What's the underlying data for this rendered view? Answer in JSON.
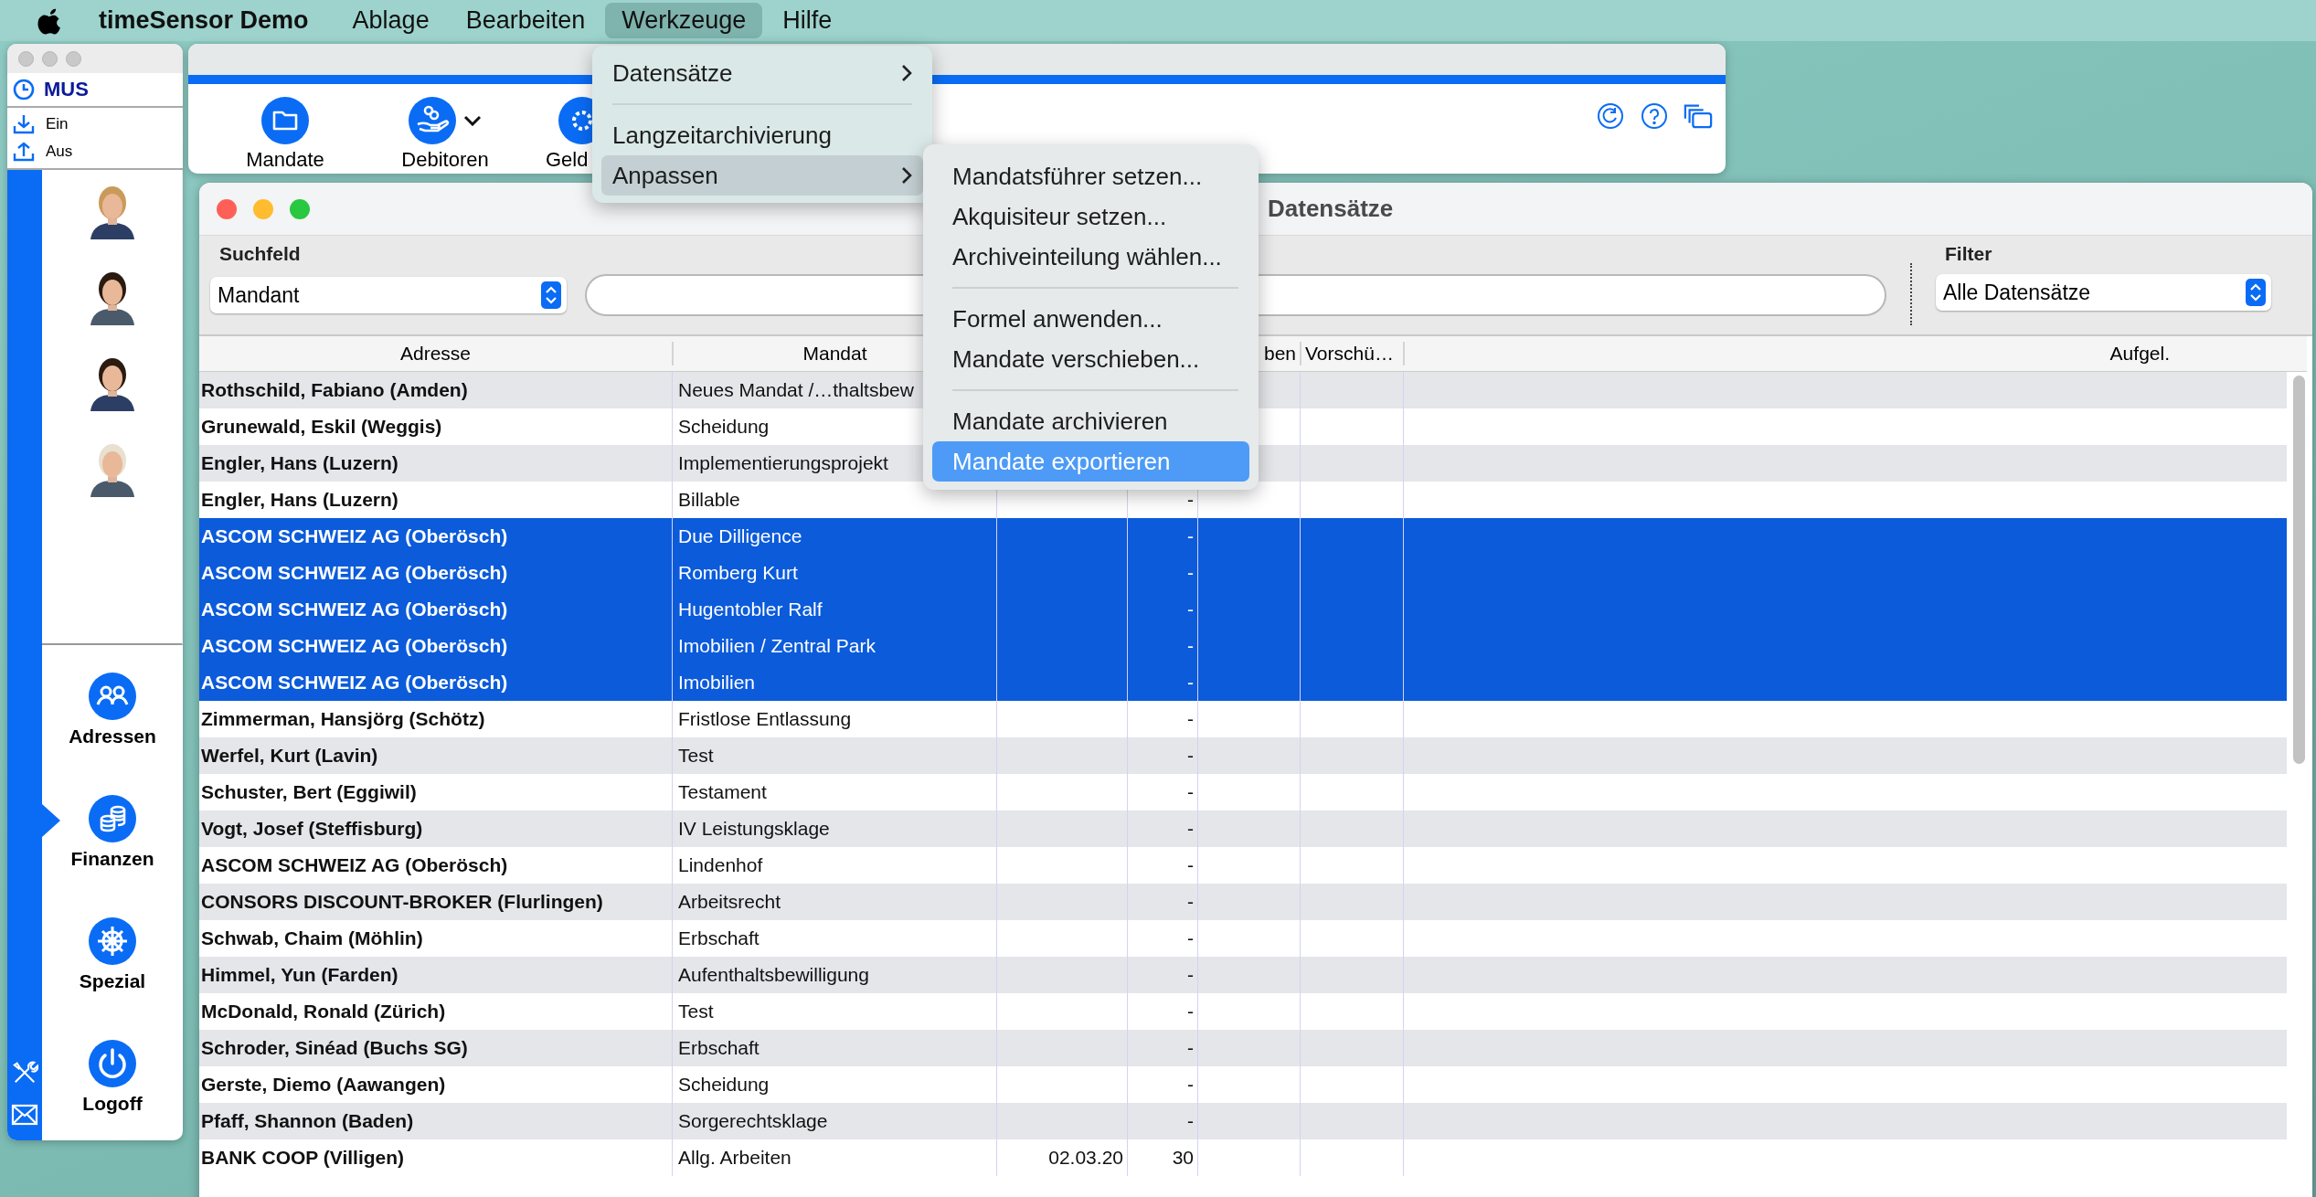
{
  "menubar": {
    "app": "timeSensor Demo",
    "items": [
      {
        "label": "Ablage",
        "selected": false
      },
      {
        "label": "Bearbeiten",
        "selected": false
      },
      {
        "label": "Werkzeuge",
        "selected": true
      },
      {
        "label": "Hilfe",
        "selected": false
      }
    ]
  },
  "menu": {
    "items": [
      {
        "kind": "submenu",
        "label": "Datensätze",
        "selected": false
      },
      {
        "kind": "separator"
      },
      {
        "kind": "item",
        "label": "Langzeitarchivierung",
        "selected": false
      },
      {
        "kind": "submenu",
        "label": "Anpassen",
        "selected": true
      }
    ]
  },
  "submenu": {
    "items": [
      {
        "kind": "item",
        "label": "Mandatsführer setzen...",
        "selected": false
      },
      {
        "kind": "item",
        "label": "Akquisiteur setzen...",
        "selected": false
      },
      {
        "kind": "item",
        "label": "Archiveinteilung wählen...",
        "selected": false
      },
      {
        "kind": "separator"
      },
      {
        "kind": "item",
        "label": "Formel anwenden...",
        "selected": false
      },
      {
        "kind": "item",
        "label": "Mandate verschieben...",
        "selected": false
      },
      {
        "kind": "separator"
      },
      {
        "kind": "item",
        "label": "Mandate archivieren",
        "selected": false
      },
      {
        "kind": "item",
        "label": "Mandate exportieren",
        "selected": true
      }
    ]
  },
  "side_panel": {
    "user": "MUS",
    "punch": [
      {
        "kind": "in",
        "label": "Ein"
      },
      {
        "kind": "out",
        "label": "Aus"
      }
    ],
    "nav": [
      {
        "kind": "people",
        "label": "Adressen",
        "selected": false
      },
      {
        "kind": "coins",
        "label": "Finanzen",
        "selected": true
      },
      {
        "kind": "wheel",
        "label": "Spezial",
        "selected": false
      },
      {
        "kind": "power",
        "label": "Logoff",
        "selected": false
      }
    ]
  },
  "toolbar": {
    "buttons": [
      {
        "kind": "folder",
        "label": "Mandate",
        "dropdown": false
      },
      {
        "kind": "hand",
        "label": "Debitoren",
        "dropdown": true
      },
      {
        "kind": "gear",
        "label": "Geld"
      }
    ]
  },
  "window": {
    "title": "Datensätze"
  },
  "search": {
    "label": "Suchfeld",
    "field": "Mandant"
  },
  "filter": {
    "label": "Filter",
    "value": "Alle Datensätze"
  },
  "table": {
    "columns": {
      "address": "Adresse",
      "mandate": "Mandat",
      "column_5": "ben",
      "column_6": "Vorschü…",
      "column_7": "Aufgel."
    },
    "rows": [
      {
        "address": "Rothschild, Fabiano (Amden)",
        "mandate": "Neues Mandat /…thaltsbew",
        "selected": false
      },
      {
        "address": "Grunewald, Eskil (Weggis)",
        "mandate": "Scheidung",
        "selected": false
      },
      {
        "address": "Engler, Hans (Luzern)",
        "mandate": "Implementierungsprojekt",
        "selected": false
      },
      {
        "address": "Engler, Hans (Luzern)",
        "mandate": "Billable",
        "column_4": "-",
        "selected": false
      },
      {
        "address": "ASCOM SCHWEIZ AG (Oberösch)",
        "mandate": "Due Dilligence",
        "column_4": "-",
        "selected": true
      },
      {
        "address": "ASCOM SCHWEIZ AG (Oberösch)",
        "mandate": "Romberg Kurt",
        "column_4": "-",
        "selected": true
      },
      {
        "address": "ASCOM SCHWEIZ AG (Oberösch)",
        "mandate": "Hugentobler Ralf",
        "column_4": "-",
        "selected": true
      },
      {
        "address": "ASCOM SCHWEIZ AG (Oberösch)",
        "mandate": "Imobilien / Zentral Park",
        "column_4": "-",
        "selected": true
      },
      {
        "address": "ASCOM SCHWEIZ AG (Oberösch)",
        "mandate": "Imobilien",
        "column_4": "-",
        "selected": true
      },
      {
        "address": "Zimmerman, Hansjörg (Schötz)",
        "mandate": "Fristlose Entlassung",
        "column_4": "-",
        "selected": false
      },
      {
        "address": "Werfel, Kurt (Lavin)",
        "mandate": "Test",
        "column_4": "-",
        "selected": false
      },
      {
        "address": "Schuster, Bert (Eggiwil)",
        "mandate": "Testament",
        "column_4": "-",
        "selected": false
      },
      {
        "address": "Vogt, Josef (Steffisburg)",
        "mandate": "IV Leistungsklage",
        "column_4": "-",
        "selected": false
      },
      {
        "address": "ASCOM SCHWEIZ AG (Oberösch)",
        "mandate": "Lindenhof",
        "column_4": "-",
        "selected": false
      },
      {
        "address": "CONSORS DISCOUNT-BROKER (Flurlingen)",
        "mandate": "Arbeitsrecht",
        "column_4": "-",
        "selected": false
      },
      {
        "address": "Schwab, Chaim (Möhlin)",
        "mandate": "Erbschaft",
        "column_4": "-",
        "selected": false
      },
      {
        "address": "Himmel, Yun (Farden)",
        "mandate": "Aufenthaltsbewilligung",
        "column_4": "-",
        "selected": false
      },
      {
        "address": "McDonald, Ronald (Zürich)",
        "mandate": "Test",
        "column_4": "-",
        "selected": false
      },
      {
        "address": "Schroder, Sinéad (Buchs SG)",
        "mandate": "Erbschaft",
        "column_4": "-",
        "selected": false
      },
      {
        "address": "Gerste, Diemo (Aawangen)",
        "mandate": "Scheidung",
        "column_4": "-",
        "selected": false
      },
      {
        "address": "Pfaff, Shannon (Baden)",
        "mandate": "Sorgerechtsklage",
        "column_4": "-",
        "selected": false
      },
      {
        "address": "BANK COOP (Villigen)",
        "mandate": "Allg. Arbeiten",
        "column_3": "02.03.20",
        "column_4": "30",
        "selected": false
      }
    ]
  }
}
